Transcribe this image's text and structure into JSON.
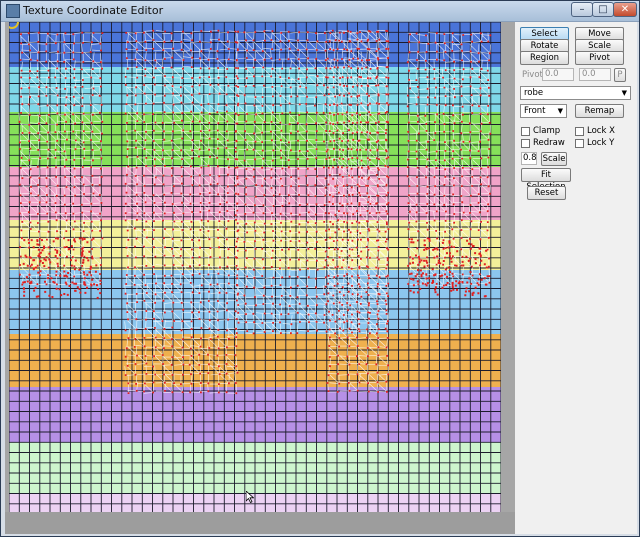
{
  "window": {
    "title": "Texture Coordinate Editor"
  },
  "window_buttons": {
    "minimize": "–",
    "maximize": "□",
    "close": "✕"
  },
  "icons": {
    "app": "texture-editor-icon",
    "cursor": "mouse-pointer-icon"
  },
  "colors": {
    "uv_band_colors": [
      "#4a74d8",
      "#7fd8e8",
      "#86e05a",
      "#f0a4c8",
      "#f3f09a",
      "#8cc6ee",
      "#efb04e",
      "#b690e6",
      "#cdf5cd",
      "#ecd2f3"
    ],
    "grid_line": "#1c1c2c",
    "mesh_wire": "#ffffff",
    "mesh_vertex": "#e02020",
    "selection_circle": "#e3c32a"
  },
  "toolbar": {
    "select": "Select",
    "move": "Move",
    "rotate": "Rotate",
    "scale": "Scale",
    "region": "Region",
    "pivot": "Pivot"
  },
  "pivot_row": {
    "label": "Pivot:",
    "x": "0.0",
    "y": "0.0",
    "p_button": "P"
  },
  "material_dropdown": {
    "value": "robe"
  },
  "view": {
    "projection": "Front",
    "remap": "Remap"
  },
  "options": {
    "clamp": {
      "label": "Clamp",
      "checked": false
    },
    "lock_x": {
      "label": "Lock X",
      "checked": false
    },
    "redraw": {
      "label": "Redraw",
      "checked": false
    },
    "lock_y": {
      "label": "Lock Y",
      "checked": false
    }
  },
  "scale_row": {
    "value": "0.8",
    "button": "Scale"
  },
  "actions": {
    "fit_selection": "Fit Selection",
    "reset": "Reset"
  }
}
